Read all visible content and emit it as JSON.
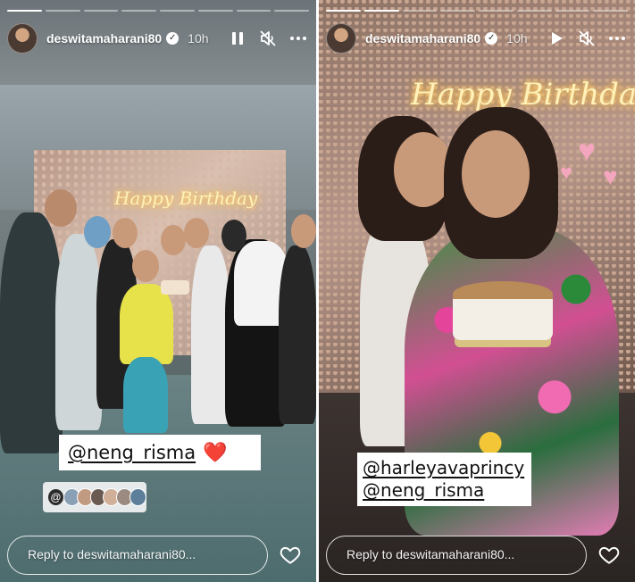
{
  "stories": [
    {
      "username": "deswitamaharani80",
      "time": "10h",
      "neon_text": "Happy Birthday",
      "tag_mention": "@neng_risma",
      "tag_emoji": "❤️",
      "reply_placeholder": "Reply to deswitamaharani80...",
      "playback_state": "playing",
      "progress_segments": 8,
      "progress_completed": 1
    },
    {
      "username": "deswitamaharani80",
      "time": "10h",
      "neon_text": "Happy Birthday",
      "tag_mention_1": "@harleyavaprincy",
      "tag_mention_2": "@neng_risma",
      "reply_placeholder": "Reply to deswitamaharani80...",
      "playback_state": "paused",
      "progress_segments": 8,
      "progress_completed": 2
    }
  ],
  "icons": {
    "pause": "pause-icon",
    "play": "play-icon",
    "mute": "speaker-muted-icon",
    "more": "more-options-icon",
    "like": "heart-outline-icon",
    "verified": "verified-badge-icon",
    "threads": "threads-icon"
  },
  "colors": {
    "heart_emoji": "#e0252a",
    "ui_white": "#ffffff"
  }
}
